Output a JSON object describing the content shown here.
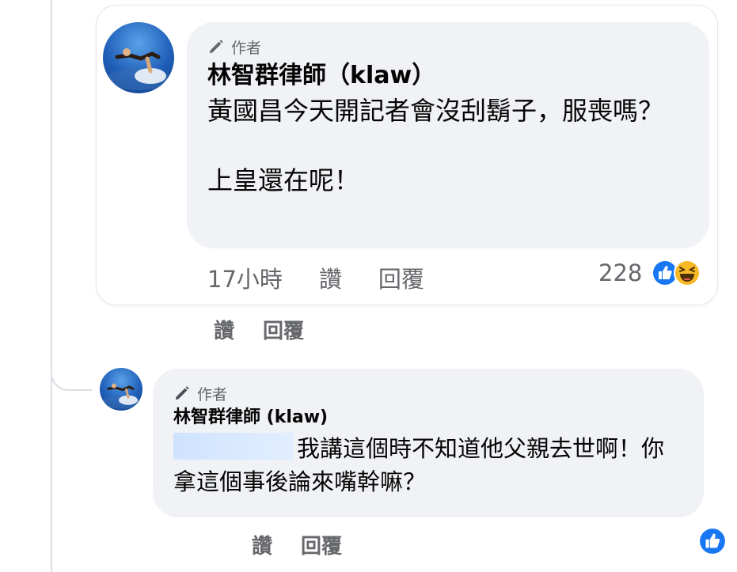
{
  "quoted_comment": {
    "author_badge": "作者",
    "author_name": "林智群律師（klaw）",
    "text": "黃國昌今天開記者會沒刮鬍子，服喪嗎？\n\n上皇還在呢！",
    "timestamp": "17小時",
    "like_label": "讚",
    "reply_label": "回覆",
    "reaction_count": "228",
    "reaction_icons": [
      "like-icon",
      "haha-icon"
    ]
  },
  "comment_actions": {
    "like_label": "讚",
    "reply_label": "回覆"
  },
  "reply_comment": {
    "author_badge": "作者",
    "author_name": "林智群律師 (klaw)",
    "text": "我講這個時不知道他父親去世啊！你拿這個事後論來嘴幹嘛？",
    "like_label": "讚",
    "reply_label": "回覆",
    "reaction_icon": "like-icon"
  },
  "colors": {
    "bubble_bg": "#f0f2f5",
    "meta_text": "#65676b",
    "like_blue": "#1877f2",
    "haha_yellow": "#f7b928"
  }
}
